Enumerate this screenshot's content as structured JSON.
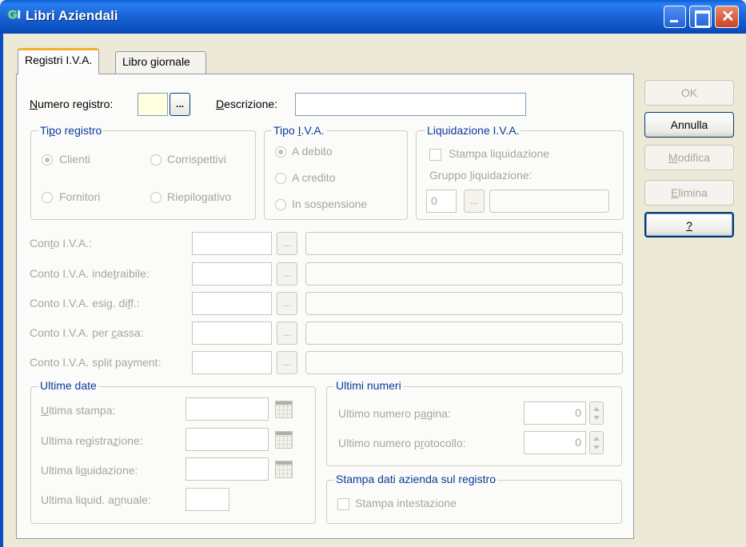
{
  "window": {
    "title": "Libri Aziendali",
    "icon_text": "G",
    "icon_suffix": "I"
  },
  "tabs": [
    {
      "label": "Registri I.V.A.",
      "active": true
    },
    {
      "label": "Libro giornale",
      "active": false
    }
  ],
  "header": {
    "numero_label_pre": "N",
    "numero_label_post": "umero registro:",
    "numero_value": "",
    "browse_button": "...",
    "descrizione_label_pre": "D",
    "descrizione_label_post": "escrizione:",
    "descrizione_value": ""
  },
  "tipo_registro": {
    "title_pre": "Ti",
    "title_u": "p",
    "title_post": "o registro",
    "options": [
      "Clienti",
      "Corrispettivi",
      "Fornitori",
      "Riepilogativo"
    ],
    "selected": "Clienti"
  },
  "tipo_iva": {
    "title_pre": "Tipo ",
    "title_u": "I",
    "title_post": ".V.A.",
    "options": [
      "A debito",
      "A credito",
      "In sospensione"
    ],
    "selected": "A debito"
  },
  "liquidazione": {
    "title": "Liquidazione I.V.A.",
    "stampa_label": "Stampa liquidazione",
    "gruppo_label_pre": "Gruppo ",
    "gruppo_label_u": "l",
    "gruppo_label_post": "iquidazione:",
    "gruppo_value": "0",
    "browse_button": "...",
    "gruppo_desc": ""
  },
  "conti": [
    {
      "pre": "Con",
      "u": "t",
      "post": "o I.V.A.:",
      "value": "",
      "desc": ""
    },
    {
      "pre": "Conto I.V.A. inde",
      "u": "t",
      "post": "raibile:",
      "value": "",
      "desc": ""
    },
    {
      "pre": "Conto I.V.A. esig. di",
      "u": "f",
      "post": "f.:",
      "value": "",
      "desc": ""
    },
    {
      "pre": "Conto I.V.A. per ",
      "u": "c",
      "post": "assa:",
      "value": "",
      "desc": ""
    },
    {
      "pre": "Conto I.V.A. split payment:",
      "u": "",
      "post": "",
      "value": "",
      "desc": ""
    }
  ],
  "conti_browse": "...",
  "ultime_date": {
    "title": "Ultime date",
    "rows": [
      {
        "pre": "",
        "u": "U",
        "post": "ltima stampa:",
        "value": ""
      },
      {
        "pre": "Ultima registra",
        "u": "z",
        "post": "ione:",
        "value": ""
      },
      {
        "pre": "Ultima li",
        "u": "q",
        "post": "uidazione:",
        "value": ""
      },
      {
        "pre": "Ultima liquid. a",
        "u": "n",
        "post": "nuale:",
        "value": ""
      }
    ]
  },
  "ultimi_numeri": {
    "title": "Ultimi numeri",
    "rows": [
      {
        "pre": "Ultimo numero p",
        "u": "a",
        "post": "gina:",
        "value": "0"
      },
      {
        "pre": "Ultimo numero p",
        "u": "r",
        "post": "otocollo:",
        "value": "0"
      }
    ]
  },
  "stampa_dati": {
    "title": "Stampa dati azienda sul registro",
    "checkbox_label": "Stampa intestazione"
  },
  "buttons": {
    "ok": "OK",
    "annulla": "Annulla",
    "modifica_u": "M",
    "modifica_post": "odifica",
    "elimina_u": "E",
    "elimina_post": "limina",
    "help": "?"
  }
}
